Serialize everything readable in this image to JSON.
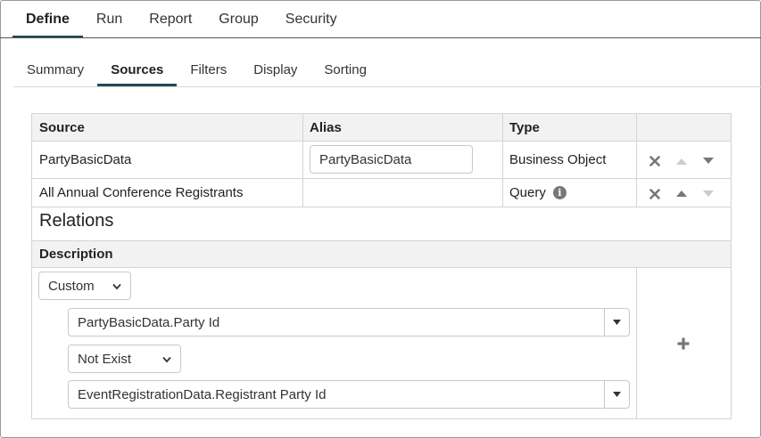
{
  "top_tabs": [
    {
      "label": "Define",
      "active": true
    },
    {
      "label": "Run",
      "active": false
    },
    {
      "label": "Report",
      "active": false
    },
    {
      "label": "Group",
      "active": false
    },
    {
      "label": "Security",
      "active": false
    }
  ],
  "sub_tabs": [
    {
      "label": "Summary",
      "active": false
    },
    {
      "label": "Sources",
      "active": true
    },
    {
      "label": "Filters",
      "active": false
    },
    {
      "label": "Display",
      "active": false
    },
    {
      "label": "Sorting",
      "active": false
    }
  ],
  "sources_table": {
    "headers": {
      "source": "Source",
      "alias": "Alias",
      "type": "Type"
    },
    "rows": [
      {
        "source": "PartyBasicData",
        "alias_value": "PartyBasicData",
        "type": "Business Object"
      },
      {
        "source": "All Annual Conference Registrants",
        "alias_value": "",
        "type": "Query"
      }
    ]
  },
  "relations": {
    "title": "Relations",
    "description_header": "Description",
    "mode_select": "Custom",
    "left_field": "PartyBasicData.Party Id",
    "operator": "Not Exist",
    "right_field": "EventRegistrationData.Registrant Party Id"
  },
  "icons": {
    "remove": "close-x-icon",
    "move_up": "triangle-up-icon",
    "move_down": "triangle-down-icon",
    "info": "info-icon",
    "add": "plus-icon"
  },
  "colors": {
    "active_tab_underline": "#1f4a57",
    "header_bg": "#f2f2f2",
    "icon_gray": "#777777",
    "icon_disabled": "#cccccc"
  }
}
